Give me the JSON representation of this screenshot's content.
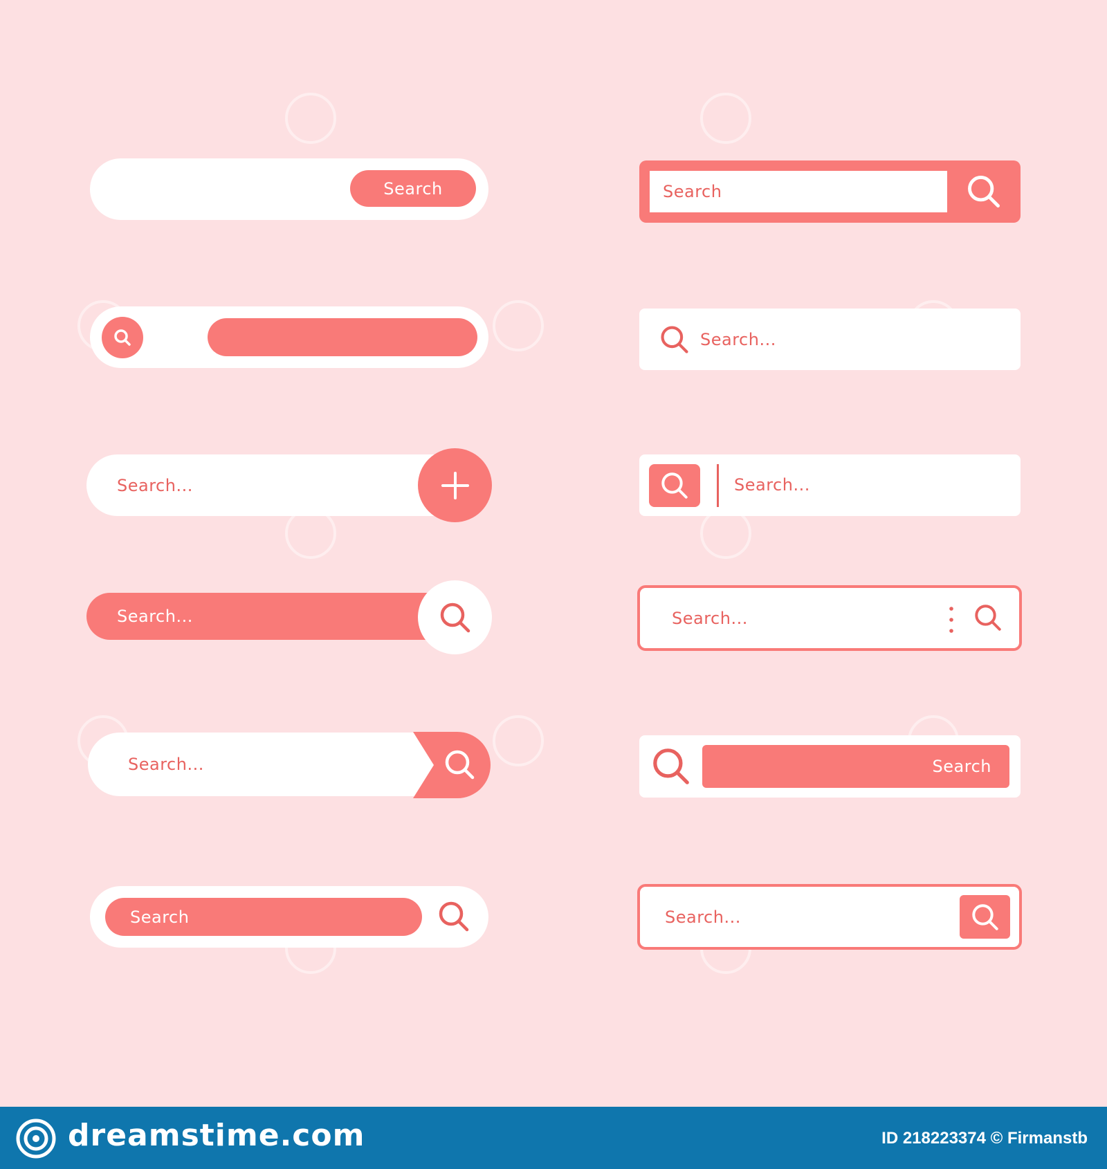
{
  "colors": {
    "background": "#fde0e2",
    "accent": "#f97a78",
    "accent_text": "#e8625f",
    "footer": "#0f76ad"
  },
  "left": {
    "bar1": {
      "button_label": "Search"
    },
    "bar2": {
      "icon": "search-icon"
    },
    "bar3": {
      "placeholder": "Search...",
      "icon": "plus-icon"
    },
    "bar4": {
      "placeholder": "Search...",
      "icon": "search-icon"
    },
    "bar5": {
      "placeholder": "Search...",
      "icon": "search-icon"
    },
    "bar6": {
      "field_label": "Search",
      "icon": "search-icon"
    }
  },
  "right": {
    "bar1": {
      "placeholder": "Search",
      "icon": "search-icon"
    },
    "bar2": {
      "placeholder": "Search...",
      "icon": "search-icon"
    },
    "bar3": {
      "placeholder": "Search...",
      "icon": "search-icon"
    },
    "bar4": {
      "placeholder": "Search...",
      "icons": [
        "more-vertical-icon",
        "search-icon"
      ]
    },
    "bar5": {
      "button_label": "Search",
      "icon": "search-icon"
    },
    "bar6": {
      "placeholder": "Search...",
      "icon": "search-icon"
    }
  },
  "footer": {
    "brand": "dreamstime.com",
    "credit": "ID 218223374 © Firmanstb"
  },
  "watermark": {
    "text": "dreamstime"
  }
}
